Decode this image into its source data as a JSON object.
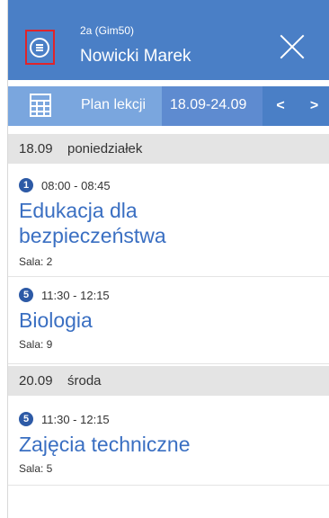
{
  "header": {
    "class_label": "2a (Gim50)",
    "student_name": "Nowicki Marek",
    "menu_icon": "menu-icon",
    "close_icon": "close-icon",
    "bg_color": "#4a7fc6"
  },
  "toolbar": {
    "plan_label": "Plan lekcji",
    "date_range": "18.09-24.09",
    "prev_label": "<",
    "next_label": ">",
    "calendar_icon": "calendar-icon",
    "bg_color": "#7aa6de"
  },
  "days": [
    {
      "date": "18.09",
      "name": "poniedziałek",
      "lessons": [
        {
          "number": "1",
          "time": "08:00 - 08:45",
          "subject_line1": "Edukacja dla",
          "subject_line2": "bezpieczeństwa",
          "room": "Sala: 2"
        },
        {
          "number": "5",
          "time": "11:30 - 12:15",
          "subject": "Biologia",
          "room": "Sala: 9"
        }
      ]
    },
    {
      "date": "20.09",
      "name": "środa",
      "lessons": [
        {
          "number": "5",
          "time": "11:30 - 12:15",
          "subject": "Zajęcia techniczne",
          "room": "Sala: 5"
        }
      ]
    }
  ]
}
